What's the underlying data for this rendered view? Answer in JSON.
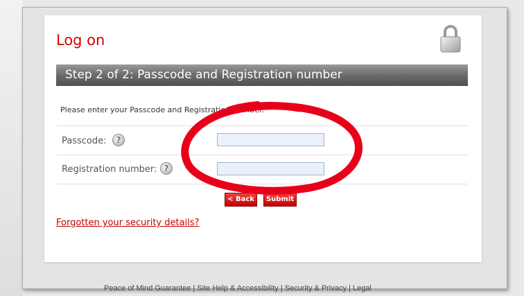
{
  "page_title": "Log on",
  "step_bar": "Step 2 of 2: Passcode and Registration number",
  "instruction": "Please enter your Passcode and Registration number.",
  "fields": {
    "passcode": {
      "label": "Passcode:",
      "value": ""
    },
    "registration": {
      "label": "Registration number:",
      "value": ""
    }
  },
  "help_glyph": "?",
  "buttons": {
    "back": "< Back",
    "submit": "Submit"
  },
  "forgot_link": "Forgotten your security details?",
  "footer": {
    "links": [
      "Peace of Mind Guarantee",
      "Site Help & Accessibility",
      "Security & Privacy",
      "Legal"
    ],
    "separator": "|"
  },
  "icons": {
    "lock": "padlock-icon",
    "help": "question-mark-icon"
  },
  "colors": {
    "brand_red": "#d40000",
    "annotation_red": "#e8001a",
    "field_bg": "#eaf1fb"
  }
}
